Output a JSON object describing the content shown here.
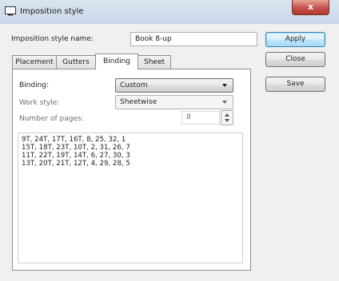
{
  "window": {
    "title": "Imposition style",
    "close_label": "x"
  },
  "style_name": {
    "label": "Imposition style name:",
    "value": "Book 8-up"
  },
  "buttons": {
    "apply": "Apply",
    "close": "Close",
    "save": "Save"
  },
  "tabs": [
    {
      "label": "Placement",
      "active": false
    },
    {
      "label": "Gutters",
      "active": false
    },
    {
      "label": "Binding",
      "active": true
    },
    {
      "label": "Sheet",
      "active": false
    }
  ],
  "binding_tab": {
    "binding_label": "Binding:",
    "binding_value": "Custom",
    "work_style_label": "Work style:",
    "work_style_value": "Sheetwise",
    "pages_label": "Number of pages:",
    "pages_value": "8",
    "sequence_lines": [
      "9T, 24T, 17T, 16T, 8, 25, 32, 1",
      "15T, 18T, 23T, 10T, 2, 31, 26, 7",
      "11T, 22T, 19T, 14T, 6, 27, 30, 3",
      "13T, 20T, 21T, 12T, 4, 29, 28, 5"
    ]
  },
  "colors": {
    "default_button_border": "#3c7fb1",
    "close_button": "#c75050",
    "titlebar": "#dbe5f1"
  }
}
